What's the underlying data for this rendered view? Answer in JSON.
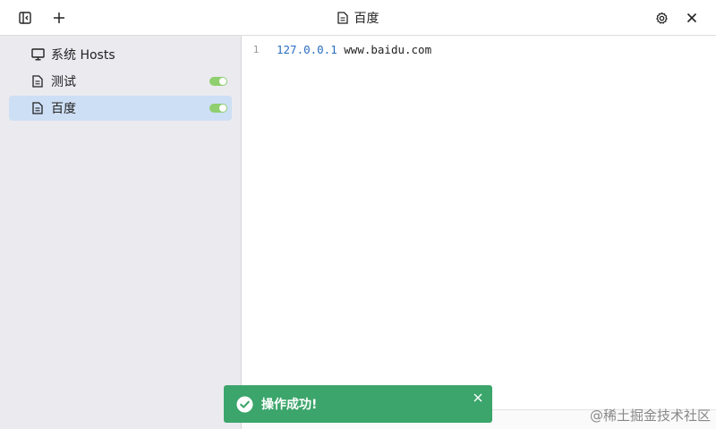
{
  "titlebar": {
    "title": "百度",
    "sidebar_toggle_icon": "sidebar-toggle-icon",
    "add_icon": "plus-icon",
    "settings_icon": "gear-icon",
    "close_icon": "close-icon"
  },
  "sidebar": {
    "items": [
      {
        "label": "系统 Hosts",
        "icon": "monitor-icon",
        "toggle": null,
        "active": false
      },
      {
        "label": "测试",
        "icon": "document-icon",
        "toggle": "on",
        "active": false
      },
      {
        "label": "百度",
        "icon": "document-icon",
        "toggle": "on",
        "active": true
      }
    ]
  },
  "editor": {
    "lines": [
      {
        "number": "1",
        "ip": "127.0.0.1",
        "host": "www.baidu.com"
      }
    ]
  },
  "toast": {
    "message": "操作成功!",
    "type": "success"
  },
  "watermark": "@稀土掘金技术社区",
  "colors": {
    "active_item": "#cddff5",
    "toggle_on": "#8fcf6f",
    "toast_bg": "#3ba56b",
    "ip_color": "#2a6ebf"
  }
}
